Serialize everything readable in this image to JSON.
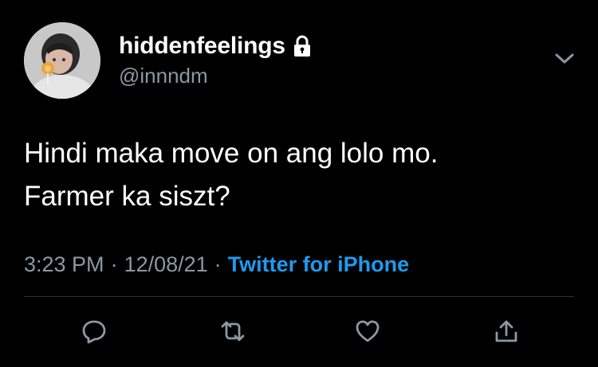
{
  "author": {
    "display_name": "hiddenfeelings",
    "handle": "@innndm",
    "protected_icon": "lock-icon"
  },
  "tweet": {
    "lines": [
      "Hindi maka move on ang lolo mo.",
      "Farmer ka siszt?"
    ]
  },
  "meta": {
    "time": "3:23 PM",
    "date": "12/08/21",
    "separator": "·",
    "source": "Twitter for iPhone"
  },
  "icons": {
    "menu": "chevron-down-icon",
    "reply": "reply-icon",
    "retweet": "retweet-icon",
    "like": "heart-icon",
    "share": "share-icon"
  },
  "colors": {
    "background": "#000000",
    "text": "#ffffff",
    "secondary": "#8b98a5",
    "link": "#1d9bf0",
    "divider": "#2f3336"
  }
}
